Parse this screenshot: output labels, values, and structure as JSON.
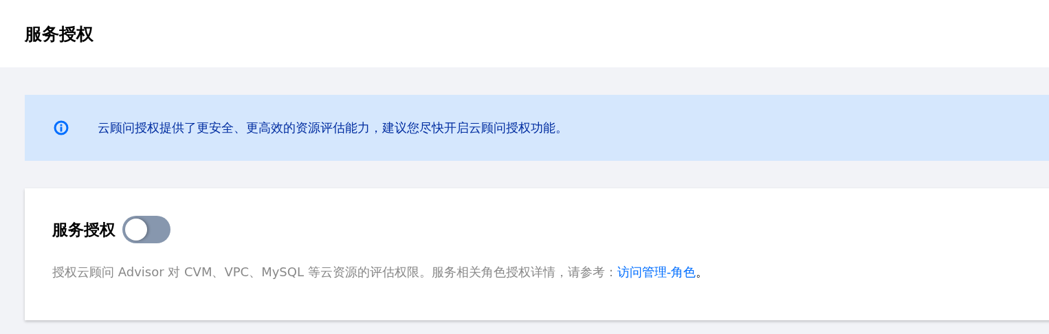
{
  "header": {
    "title": "服务授权"
  },
  "notice": {
    "text": "云顾问授权提供了更安全、更高效的资源评估能力，建议您尽快开启云顾问授权功能。"
  },
  "card": {
    "title": "服务授权",
    "toggle": {
      "on": false
    },
    "description": {
      "text": "授权云顾问 Advisor 对 CVM、VPC、MySQL 等云资源的评估权限。服务相关角色授权详情，请参考：",
      "link": "访问管理-角色",
      "suffix": "。"
    }
  }
}
